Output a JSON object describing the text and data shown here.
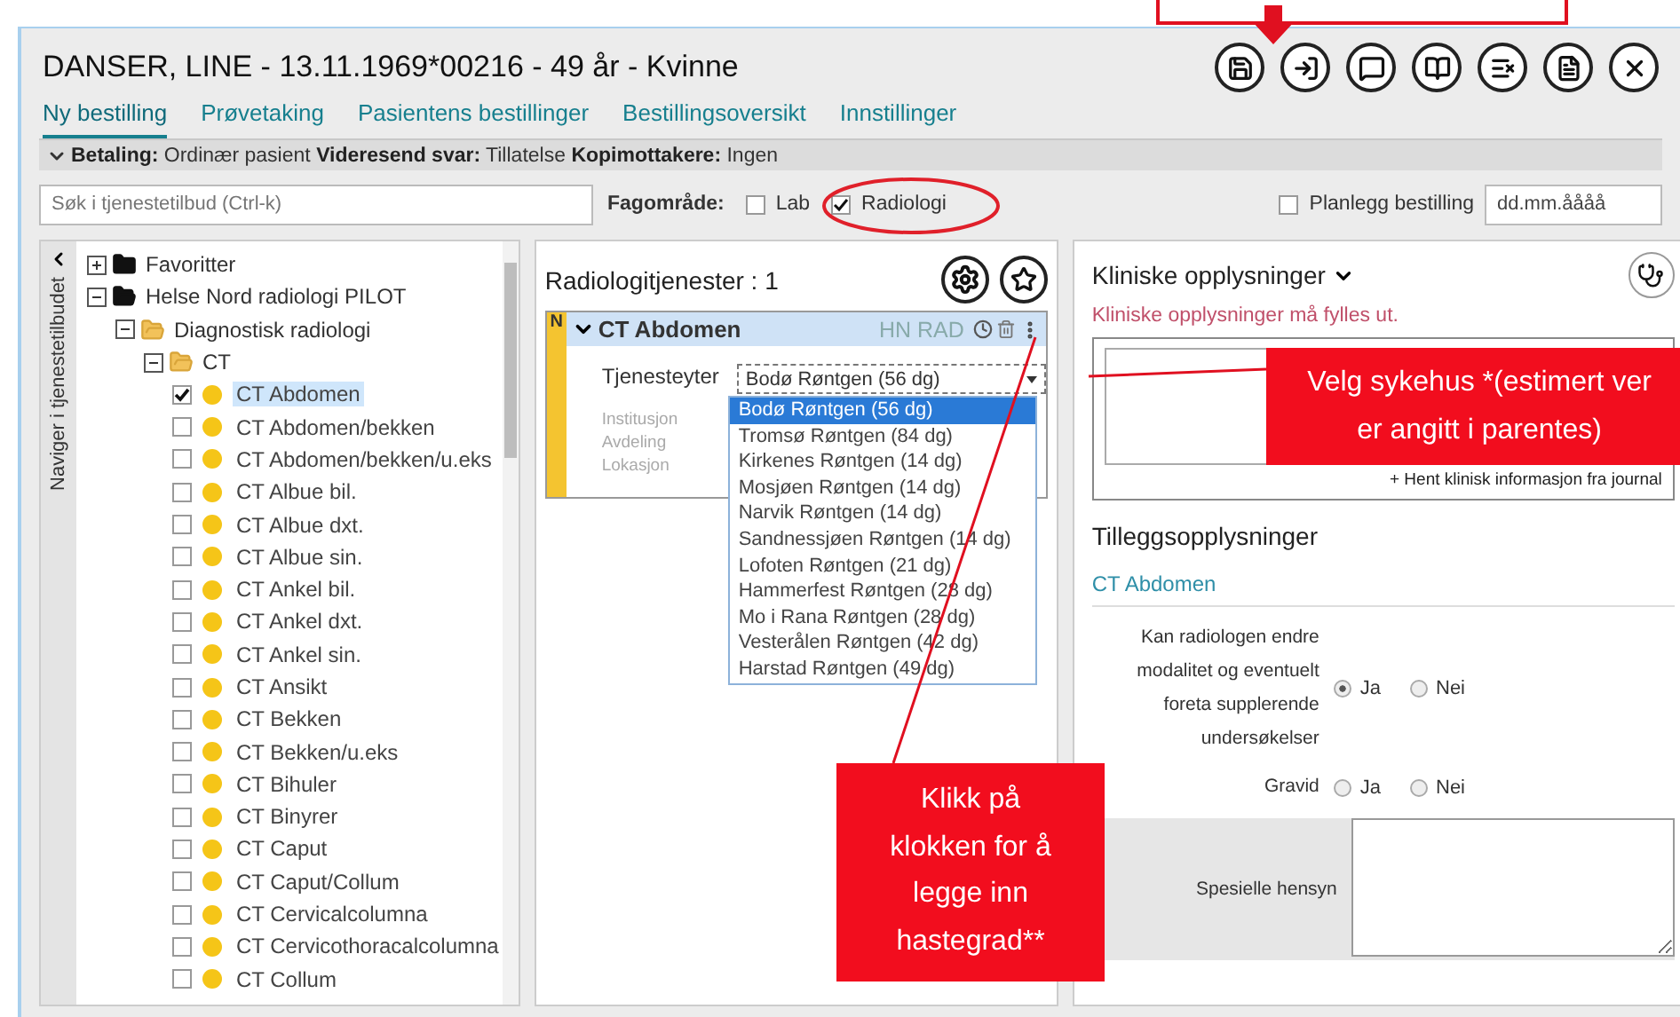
{
  "header": {
    "title": "DANSER, LINE - 13.11.1969*00216 - 49 år - Kvinne"
  },
  "tabs": [
    {
      "label": "Ny bestilling",
      "selected": true
    },
    {
      "label": "Prøvetaking",
      "selected": false
    },
    {
      "label": "Pasientens bestillinger",
      "selected": false
    },
    {
      "label": "Bestillingsoversikt",
      "selected": false
    },
    {
      "label": "Innstillinger",
      "selected": false
    }
  ],
  "info_bar": {
    "expanded": true,
    "text": "**Betaling:** Ordinær pasient **Videresend svar:** Tillatelse **Kopimottakere:** Ingen"
  },
  "search": {
    "placeholder": "Søk i tjenestetilbud (Ctrl-k)"
  },
  "fagomrade": {
    "label": "Fagområde:",
    "options": [
      {
        "label": "Lab",
        "checked": false
      },
      {
        "label": "Radiologi",
        "checked": true
      }
    ]
  },
  "planning": {
    "label": "Planlegg bestilling",
    "checked": false,
    "date_placeholder": "dd.mm.åååå"
  },
  "sidebar": {
    "vertical_label": "Naviger i tjenestetilbudet",
    "tree": [
      {
        "kind": "folder",
        "label": "Favoritter",
        "expanded": false
      },
      {
        "kind": "folder",
        "label": "Helse Nord radiologi PILOT",
        "expanded": true,
        "children": [
          {
            "kind": "folder",
            "label": "Diagnostisk radiologi",
            "expanded": true,
            "children": [
              {
                "kind": "folder",
                "label": "CT",
                "expanded": true,
                "children": [
                  {
                    "kind": "item",
                    "label": "CT Abdomen",
                    "checked": true,
                    "selected": true
                  },
                  {
                    "kind": "item",
                    "label": "CT Abdomen/bekken",
                    "checked": false,
                    "selected": false
                  },
                  {
                    "kind": "item",
                    "label": "CT Abdomen/bekken/u.eks",
                    "checked": false,
                    "selected": false
                  },
                  {
                    "kind": "item",
                    "label": "CT Albue bil.",
                    "checked": false,
                    "selected": false
                  },
                  {
                    "kind": "item",
                    "label": "CT Albue dxt.",
                    "checked": false,
                    "selected": false
                  },
                  {
                    "kind": "item",
                    "label": "CT Albue sin.",
                    "checked": false,
                    "selected": false
                  },
                  {
                    "kind": "item",
                    "label": "CT Ankel bil.",
                    "checked": false,
                    "selected": false
                  },
                  {
                    "kind": "item",
                    "label": "CT Ankel dxt.",
                    "checked": false,
                    "selected": false
                  },
                  {
                    "kind": "item",
                    "label": "CT Ankel sin.",
                    "checked": false,
                    "selected": false
                  },
                  {
                    "kind": "item",
                    "label": "CT Ansikt",
                    "checked": false,
                    "selected": false
                  },
                  {
                    "kind": "item",
                    "label": "CT Bekken",
                    "checked": false,
                    "selected": false
                  },
                  {
                    "kind": "item",
                    "label": "CT Bekken/u.eks",
                    "checked": false,
                    "selected": false
                  },
                  {
                    "kind": "item",
                    "label": "CT Bihuler",
                    "checked": false,
                    "selected": false
                  },
                  {
                    "kind": "item",
                    "label": "CT Binyrer",
                    "checked": false,
                    "selected": false
                  },
                  {
                    "kind": "item",
                    "label": "CT Caput",
                    "checked": false,
                    "selected": false
                  },
                  {
                    "kind": "item",
                    "label": "CT Caput/Collum",
                    "checked": false,
                    "selected": false
                  },
                  {
                    "kind": "item",
                    "label": "CT Cervicalcolumna",
                    "checked": false,
                    "selected": false
                  },
                  {
                    "kind": "item",
                    "label": "CT Cervicothoracalcolumna",
                    "checked": false,
                    "selected": false
                  },
                  {
                    "kind": "item",
                    "label": "CT Collum",
                    "checked": false,
                    "selected": false
                  }
                ]
              }
            ]
          }
        ]
      }
    ]
  },
  "services": {
    "title": "Radiologitjenester : 1",
    "order": {
      "flag": "N",
      "name": "CT Abdomen",
      "expanded": true,
      "source": "HN RAD",
      "provider_label": "Tjenesteyter",
      "provider_value": "Bodø Røntgen (56 dg)",
      "labels": [
        "Institusjon",
        "Avdeling",
        "Lokasjon"
      ],
      "options": [
        {
          "label": "Bodø Røntgen (56 dg)",
          "selected": true
        },
        {
          "label": "Tromsø Røntgen (84 dg)",
          "selected": false
        },
        {
          "label": "Kirkenes Røntgen (14 dg)",
          "selected": false
        },
        {
          "label": "Mosjøen Røntgen (14 dg)",
          "selected": false
        },
        {
          "label": "Narvik Røntgen (14 dg)",
          "selected": false
        },
        {
          "label": "Sandnessjøen Røntgen (14 dg)",
          "selected": false
        },
        {
          "label": "Lofoten Røntgen (21 dg)",
          "selected": false
        },
        {
          "label": "Hammerfest Røntgen (28 dg)",
          "selected": false
        },
        {
          "label": "Mo i Rana Røntgen (28 dg)",
          "selected": false
        },
        {
          "label": "Vesterålen Røntgen (42 dg)",
          "selected": false
        },
        {
          "label": "Harstad Røntgen (49 dg)",
          "selected": false
        }
      ]
    }
  },
  "clinical": {
    "title": "Kliniske opplysninger",
    "error": "Kliniske opplysninger må fylles ut.",
    "link": "+ Hent klinisk informasjon fra journal"
  },
  "extra": {
    "title": "Tilleggsopplysninger",
    "exam": "CT Abdomen",
    "questions": [
      {
        "label": "Kan radiologen endre modalitet og eventuelt foreta supplerende undersøkelser",
        "options": [
          {
            "label": "Ja",
            "selected": true
          },
          {
            "label": "Nei",
            "selected": false
          }
        ]
      },
      {
        "label": "Gravid",
        "options": [
          {
            "label": "Ja",
            "selected": false
          },
          {
            "label": "Nei",
            "selected": false
          }
        ]
      }
    ],
    "special_label": "Spesielle hensyn"
  },
  "callouts": [
    {
      "kind": "hospital",
      "lines": [
        "Velg sykehus *(estimert ver",
        "er angitt i parentes)"
      ]
    },
    {
      "kind": "clock",
      "lines": [
        "Klikk på",
        "klokken for å",
        "legge inn",
        "hastegrad**"
      ]
    }
  ]
}
